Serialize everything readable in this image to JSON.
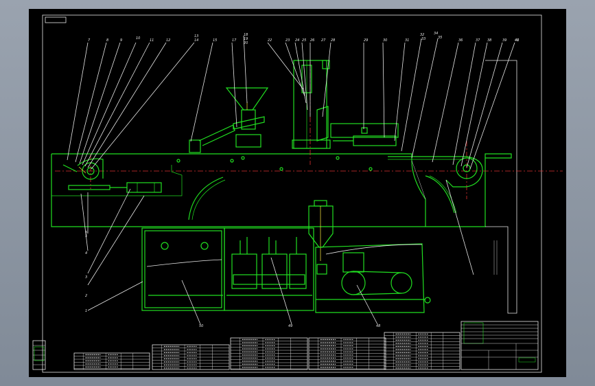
{
  "viewer": {
    "background_color": "#8d96a3",
    "sheet_color": "#000000",
    "line_color": "#21e021",
    "leader_color": "#e8e8e8",
    "centerline_color": "#e03030"
  },
  "balloons": {
    "top": [
      "7",
      "8",
      "9",
      "10",
      "11",
      "12",
      "13",
      "14",
      "15",
      "17",
      "18",
      "19",
      "20",
      "22",
      "23",
      "24",
      "25",
      "26",
      "27",
      "28",
      "29",
      "30",
      "31",
      "32",
      "33",
      "34",
      "35",
      "36",
      "37",
      "38",
      "39",
      "40",
      "41"
    ],
    "bottom": [
      "1",
      "2",
      "3",
      "4",
      "5",
      "6",
      "50",
      "49",
      "48"
    ]
  },
  "title_block": {
    "title": "",
    "cells": [
      "",
      "",
      "",
      "",
      "",
      "",
      "",
      "",
      "",
      "",
      ""
    ]
  }
}
